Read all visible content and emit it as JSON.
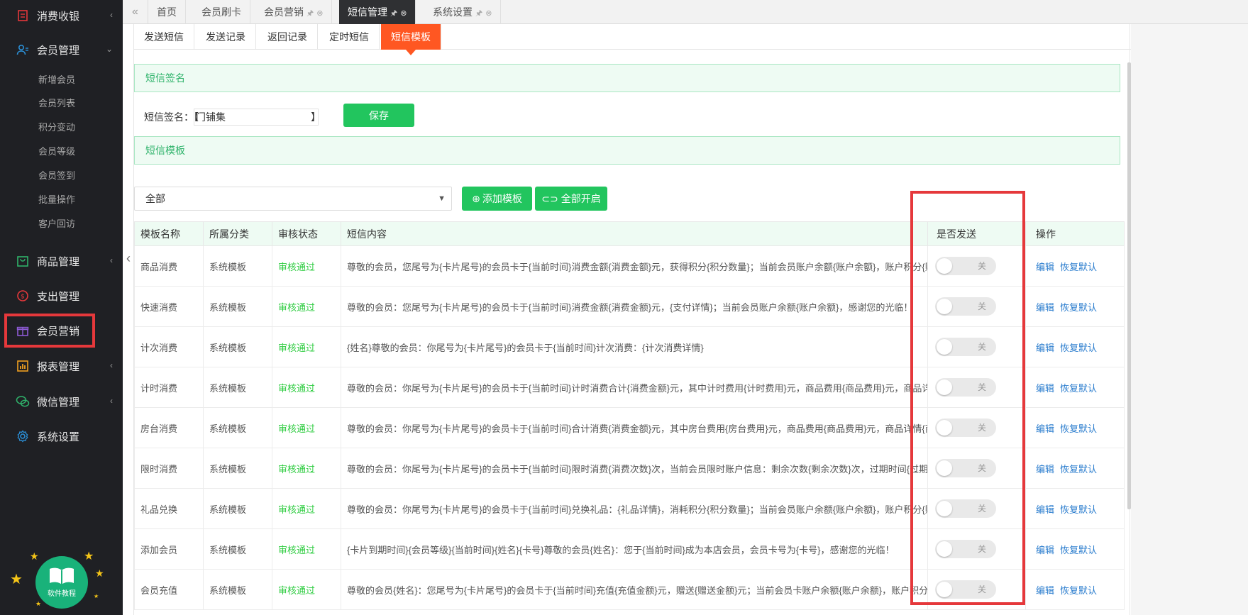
{
  "sidebar": {
    "items": [
      {
        "label": "消费收银",
        "icon": "cashier-icon",
        "color": "#e5383b",
        "arrow": "‹"
      },
      {
        "label": "会员管理",
        "icon": "user-list-icon",
        "color": "#2b8fd6",
        "arrow": "⌄"
      },
      {
        "label": "商品管理",
        "icon": "goods-icon",
        "color": "#2fb36b",
        "arrow": "‹"
      },
      {
        "label": "支出管理",
        "icon": "expense-icon",
        "color": "#e5383b",
        "arrow": ""
      },
      {
        "label": "会员营销",
        "icon": "gift-icon",
        "color": "#8e5bd6",
        "arrow": ""
      },
      {
        "label": "报表管理",
        "icon": "chart-icon",
        "color": "#f0a020",
        "arrow": "‹"
      },
      {
        "label": "微信管理",
        "icon": "wechat-icon",
        "color": "#2fb36b",
        "arrow": "‹"
      },
      {
        "label": "系统设置",
        "icon": "settings-icon",
        "color": "#2b8fd6",
        "arrow": ""
      }
    ],
    "subitems": [
      "新增会员",
      "会员列表",
      "积分变动",
      "会员等级",
      "会员签到",
      "批量操作",
      "客户回访"
    ],
    "tutorial": "软件教程"
  },
  "tabs": [
    {
      "label": "首页"
    },
    {
      "label": "会员刷卡"
    },
    {
      "label": "会员营销"
    },
    {
      "label": "短信管理"
    },
    {
      "label": "系统设置"
    }
  ],
  "subtabs": [
    "发送短信",
    "发送记录",
    "返回记录",
    "定时短信",
    "短信模板"
  ],
  "signature": {
    "section_title": "短信签名",
    "label": "短信签名：",
    "bracket_left": "【",
    "bracket_right": "】",
    "value": "门铺集",
    "save": "保存"
  },
  "templates": {
    "section_title": "短信模板",
    "filter_selected": "全部",
    "add_button": "添加模板",
    "enable_all_button": "全部开启"
  },
  "table": {
    "headers": [
      "模板名称",
      "所属分类",
      "审核状态",
      "短信内容",
      "是否发送",
      "操作"
    ],
    "toggle_off_label": "关",
    "edit": "编辑",
    "restore": "恢复默认",
    "rows": [
      {
        "name": "商品消费",
        "category": "系统模板",
        "status": "审核通过",
        "content": "尊敬的会员，您尾号为{卡片尾号}的会员卡于{当前时间}消费金额{消费金额}元，获得积分{积分数量}；当前会员账户余额{账户余额}，账户积分{账户积分}"
      },
      {
        "name": "快速消费",
        "category": "系统模板",
        "status": "审核通过",
        "content": "尊敬的会员：您尾号为{卡片尾号}的会员卡于{当前时间}消费金额{消费金额}元，{支付详情}；当前会员账户余额{账户余额}，感谢您的光临！"
      },
      {
        "name": "计次消费",
        "category": "系统模板",
        "status": "审核通过",
        "content": "{姓名}尊敬的会员：你尾号为{卡片尾号}的会员卡于{当前时间}计次消费：{计次消费详情}"
      },
      {
        "name": "计时消费",
        "category": "系统模板",
        "status": "审核通过",
        "content": "尊敬的会员：你尾号为{卡片尾号}的会员卡于{当前时间}计时消费合计{消费金额}元，其中计时费用{计时费用}元，商品费用{商品费用}元，商品详情{商品详情}"
      },
      {
        "name": "房台消费",
        "category": "系统模板",
        "status": "审核通过",
        "content": "尊敬的会员：你尾号为{卡片尾号}的会员卡于{当前时间}合计消费{消费金额}元，其中房台费用{房台费用}元，商品费用{商品费用}元，商品详情{商品详情}"
      },
      {
        "name": "限时消费",
        "category": "系统模板",
        "status": "审核通过",
        "content": "尊敬的会员：你尾号为{卡片尾号}的会员卡于{当前时间}限时消费{消费次数}次，当前会员限时账户信息：剩余次数{剩余次数}次，过期时间{过期时间}"
      },
      {
        "name": "礼品兑换",
        "category": "系统模板",
        "status": "审核通过",
        "content": "尊敬的会员：你尾号为{卡片尾号}的会员卡于{当前时间}兑换礼品：{礼品详情}，消耗积分{积分数量}；当前会员账户余额{账户余额}，账户积分{账户积分}"
      },
      {
        "name": "添加会员",
        "category": "系统模板",
        "status": "审核通过",
        "content": "{卡片到期时间}{会员等级}{当前时间}{姓名}{卡号}尊敬的会员{姓名}：您于{当前时间}成为本店会员，会员卡号为{卡号}，感谢您的光临！"
      },
      {
        "name": "会员充值",
        "category": "系统模板",
        "status": "审核通过",
        "content": "尊敬的会员{姓名}：您尾号为{卡片尾号}的会员卡于{当前时间}充值{充值金额}元，赠送{赠送金额}元；当前会员卡账户余额{账户余额}，账户积分{账户积分}"
      }
    ]
  }
}
